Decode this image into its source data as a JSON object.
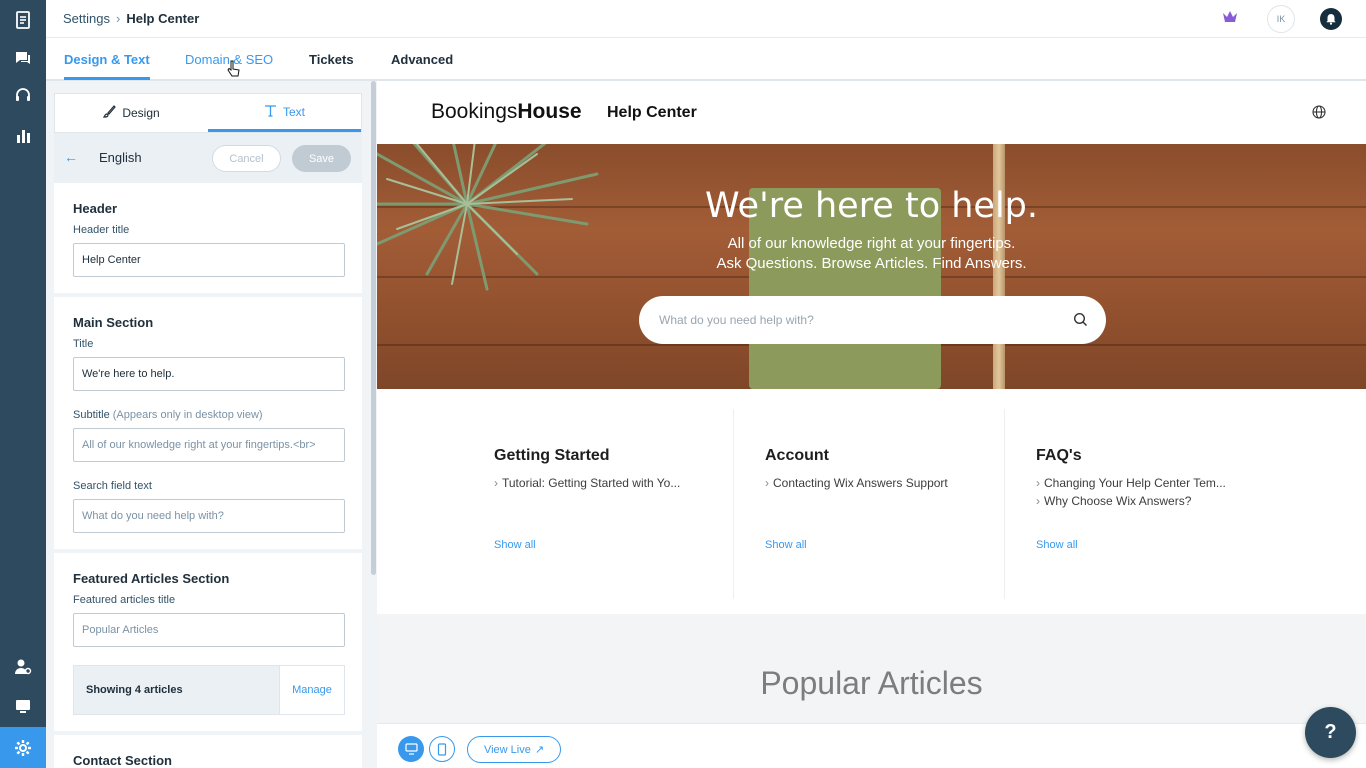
{
  "breadcrumb": {
    "parent": "Settings",
    "separator": "›",
    "current": "Help Center"
  },
  "header": {
    "avatar_initials": "IK"
  },
  "tabs": [
    {
      "label": "Design & Text",
      "active": true
    },
    {
      "label": "Domain & SEO",
      "active": false
    },
    {
      "label": "Tickets",
      "active": false
    },
    {
      "label": "Advanced",
      "active": false
    }
  ],
  "panel": {
    "subtabs": [
      {
        "label": "Design",
        "icon": "brush-icon",
        "active": false
      },
      {
        "label": "Text",
        "icon": "text-icon",
        "active": true
      }
    ],
    "language": "English",
    "cancel_label": "Cancel",
    "save_label": "Save",
    "sections": {
      "header": {
        "title": "Header",
        "header_title_label": "Header title",
        "header_title_value": "Help Center"
      },
      "main": {
        "title": "Main Section",
        "title_label": "Title",
        "title_value": "We're here to help.",
        "subtitle_label": "Subtitle",
        "subtitle_hint": "(Appears only in desktop view)",
        "subtitle_value": "All of our knowledge right at your fingertips.<br>",
        "search_label": "Search field text",
        "search_value": "What do you need help with?"
      },
      "featured": {
        "title": "Featured Articles Section",
        "articles_title_label": "Featured articles title",
        "articles_title_value": "Popular Articles",
        "showing": "Showing 4 articles",
        "manage": "Manage"
      },
      "contact": {
        "title": "Contact Section"
      }
    }
  },
  "preview": {
    "logo_light": "Bookings",
    "logo_bold": "House",
    "site_title": "Help Center",
    "hero_title": "We're here to help.",
    "hero_sub_1": "All of our knowledge right at your fingertips.",
    "hero_sub_2": "Ask Questions. Browse Articles. Find Answers.",
    "search_placeholder": "What do you need help with?",
    "categories": [
      {
        "title": "Getting Started",
        "articles": [
          "Tutorial: Getting Started with Yo..."
        ],
        "show_all": "Show all"
      },
      {
        "title": "Account",
        "articles": [
          "Contacting Wix Answers Support"
        ],
        "show_all": "Show all"
      },
      {
        "title": "FAQ's",
        "articles": [
          "Changing Your Help Center Tem...",
          "Why Choose Wix Answers?"
        ],
        "show_all": "Show all"
      }
    ],
    "popular_title": "Popular Articles",
    "view_live": "View Live",
    "help_fab": "?"
  },
  "colors": {
    "accent": "#3899ec",
    "rail": "#2e4a5e",
    "text_dark": "#20303c"
  }
}
